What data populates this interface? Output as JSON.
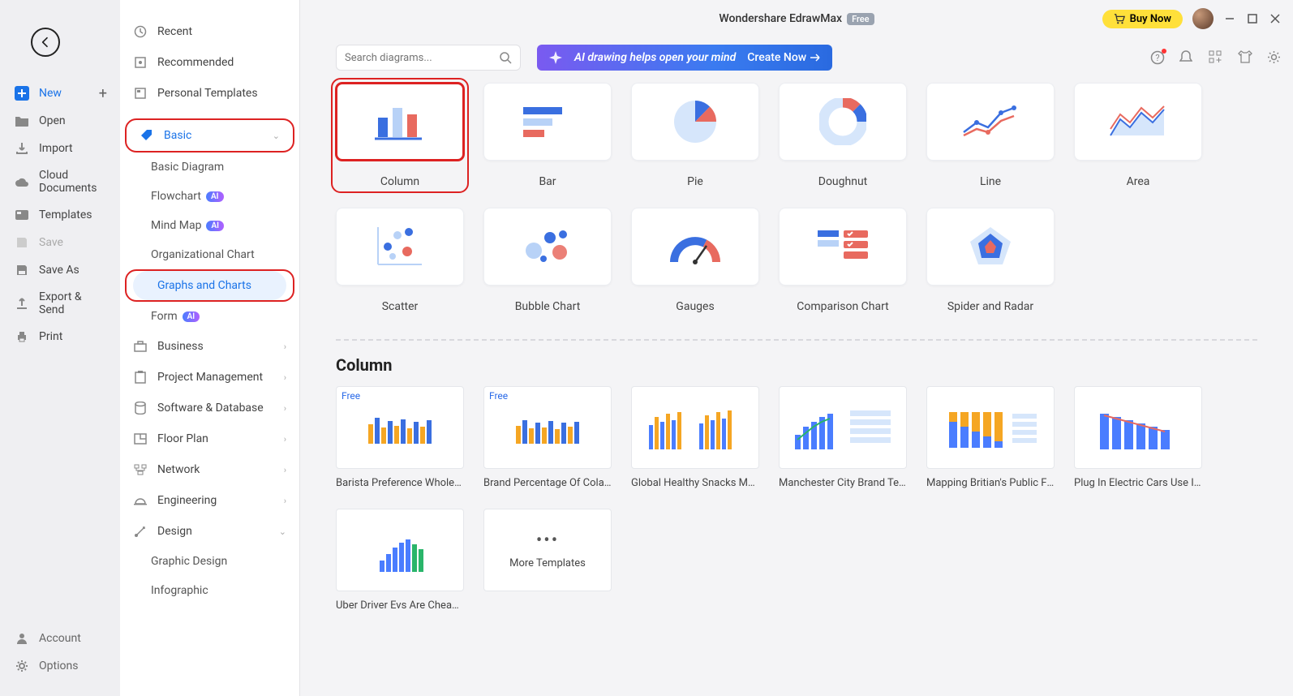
{
  "app": {
    "title": "Wondershare EdrawMax",
    "badge": "Free"
  },
  "top": {
    "buy": "Buy Now"
  },
  "search": {
    "placeholder": "Search diagrams..."
  },
  "banner": {
    "text": "AI drawing helps open your mind",
    "cta": "Create Now"
  },
  "rail": {
    "new": "New",
    "open": "Open",
    "import": "Import",
    "cloud": "Cloud Documents",
    "templates": "Templates",
    "save": "Save",
    "saveas": "Save As",
    "export": "Export & Send",
    "print": "Print",
    "account": "Account",
    "options": "Options"
  },
  "cat": {
    "recent": "Recent",
    "recommended": "Recommended",
    "personal": "Personal Templates",
    "basic": "Basic",
    "basic_sub": {
      "diagram": "Basic Diagram",
      "flowchart": "Flowchart",
      "mindmap": "Mind Map",
      "org": "Organizational Chart",
      "graphs": "Graphs and Charts",
      "form": "Form"
    },
    "ai": "AI",
    "business": "Business",
    "pm": "Project Management",
    "sw": "Software & Database",
    "floor": "Floor Plan",
    "network": "Network",
    "eng": "Engineering",
    "design": "Design",
    "graphic": "Graphic Design",
    "infographic": "Infographic"
  },
  "tiles": {
    "column": "Column",
    "bar": "Bar",
    "pie": "Pie",
    "doughnut": "Doughnut",
    "line": "Line",
    "area": "Area",
    "scatter": "Scatter",
    "bubble": "Bubble Chart",
    "gauges": "Gauges",
    "comparison": "Comparison Chart",
    "radar": "Spider and Radar"
  },
  "section": {
    "title": "Column"
  },
  "templates": [
    {
      "label": "Barista Preference Whole ...",
      "free": true
    },
    {
      "label": "Brand Percentage Of Cola ...",
      "free": true
    },
    {
      "label": "Global Healthy Snacks Mar...",
      "free": false
    },
    {
      "label": "Manchester City Brand Tea...",
      "free": false
    },
    {
      "label": "Mapping Britian's Public Fi...",
      "free": false
    },
    {
      "label": "Plug In Electric Cars Use In ...",
      "free": false
    },
    {
      "label": "Uber Driver Evs Are Cheap...",
      "free": false
    }
  ],
  "more": "More Templates"
}
